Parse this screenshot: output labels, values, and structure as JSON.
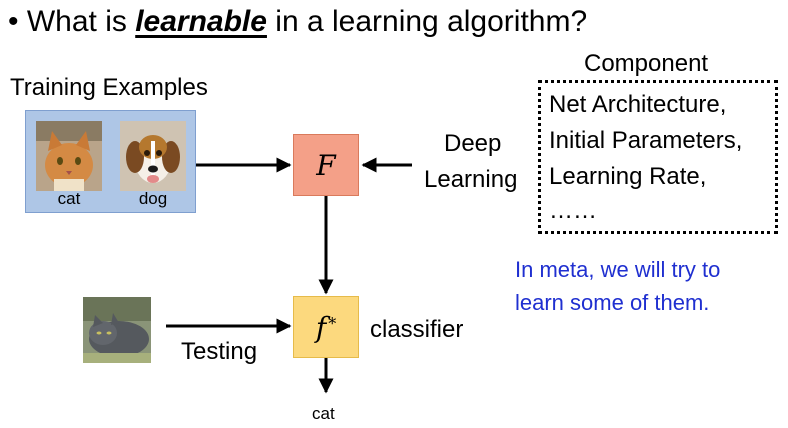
{
  "title": {
    "bullet": "•",
    "before": "What is ",
    "keyword": "learnable",
    "after": " in a learning algorithm?"
  },
  "training_examples": {
    "label": "Training Examples",
    "images": [
      {
        "caption": "cat",
        "icon": "cat-photo-icon"
      },
      {
        "caption": "dog",
        "icon": "dog-photo-icon"
      }
    ]
  },
  "function_box": {
    "symbol": "F"
  },
  "classifier_box": {
    "symbol": "f",
    "superscript": "*",
    "label": "classifier"
  },
  "deep_learning": {
    "line1": "Deep",
    "line2": "Learning"
  },
  "component": {
    "header": "Component",
    "items": [
      "Net Architecture,",
      "Initial Parameters,",
      "Learning Rate,",
      "……"
    ]
  },
  "note": {
    "line1": "In meta, we will try to",
    "line2": "learn some of them."
  },
  "testing": {
    "label": "Testing",
    "icon": "gray-cat-photo-icon"
  },
  "output": {
    "label": "cat"
  },
  "colors": {
    "training_box": "#aec6e6",
    "function_box": "#f4a088",
    "classifier_box": "#fcd97e",
    "note_text": "#1f2fd0"
  }
}
